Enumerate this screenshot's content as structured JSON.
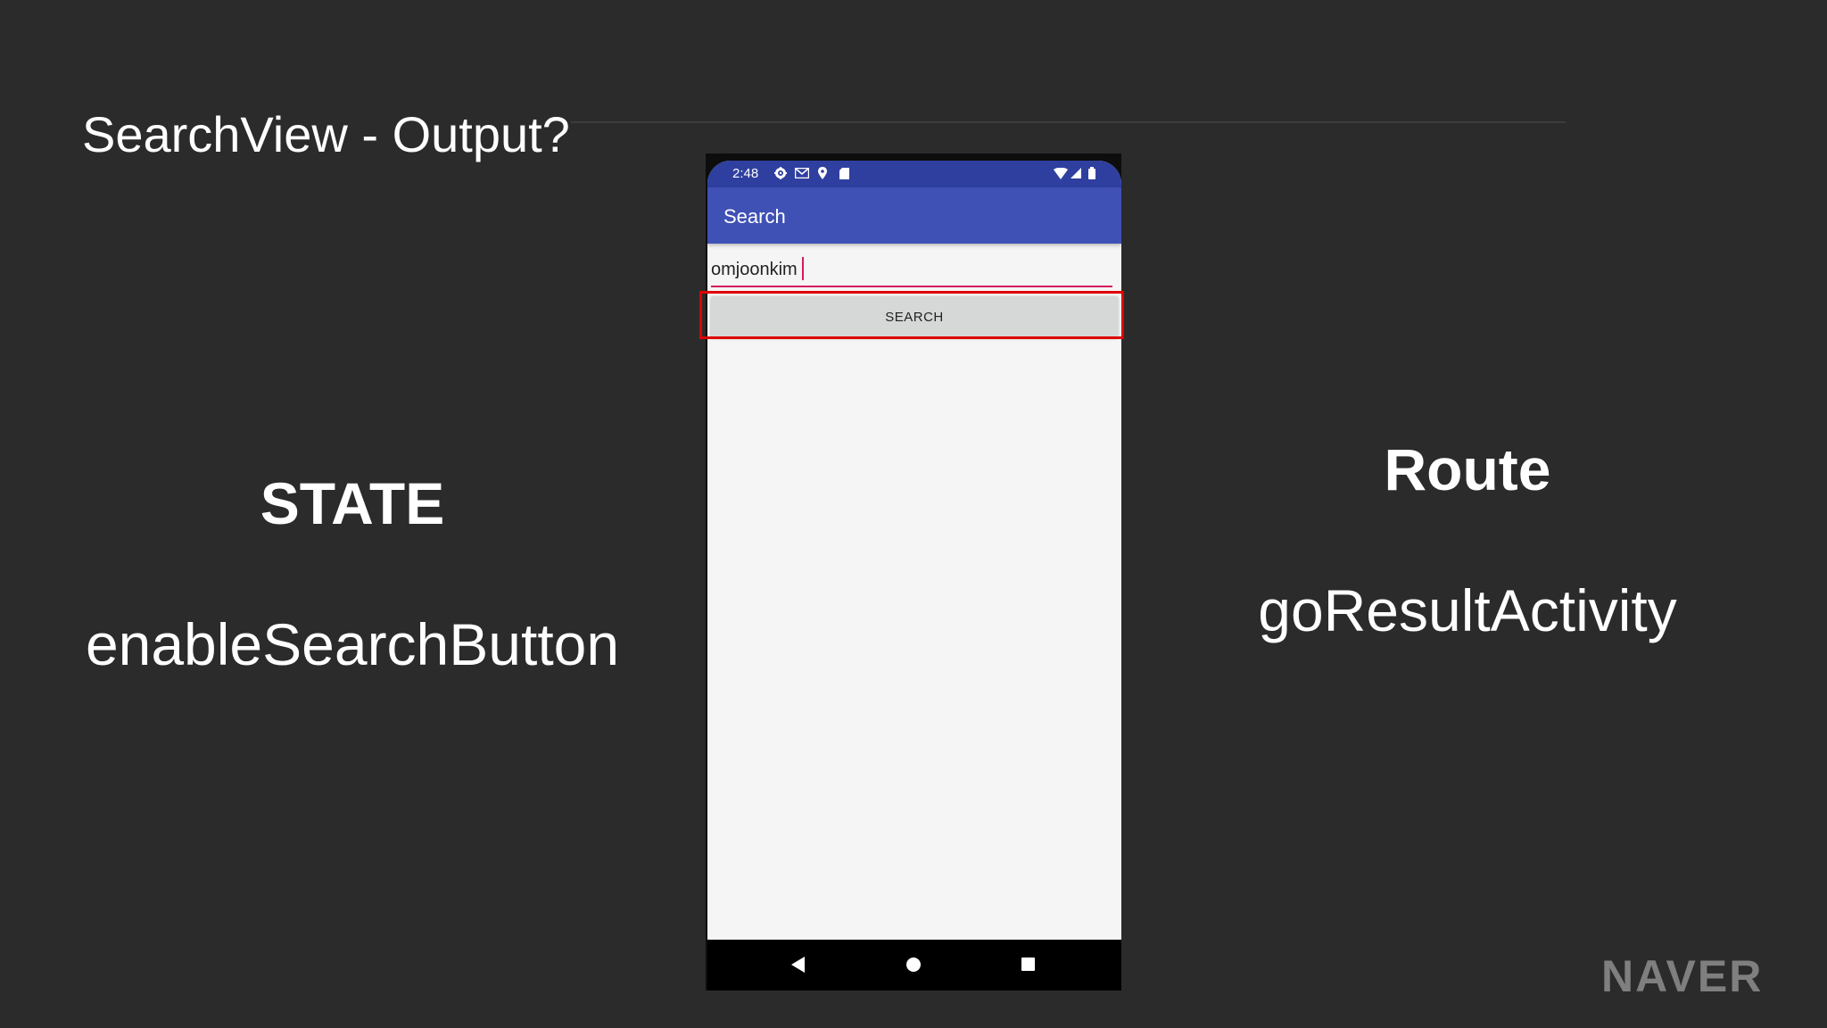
{
  "slide": {
    "title": "SearchView - Output?",
    "state_heading": "STATE",
    "state_value": "enableSearchButton",
    "route_heading": "Route",
    "route_value": "goResultActivity",
    "logo": "NAVER"
  },
  "phone": {
    "status_bar": {
      "time": "2:48",
      "left_icons": [
        "gear-icon",
        "mail-icon",
        "location-icon",
        "sd-card-icon"
      ],
      "right_icons": [
        "wifi-icon",
        "signal-icon",
        "battery-icon"
      ]
    },
    "app_bar": {
      "title": "Search"
    },
    "search": {
      "value": "omjoonkim",
      "button_label": "SEARCH"
    },
    "nav_bar": {
      "buttons": [
        "back-icon",
        "home-icon",
        "recents-icon"
      ]
    }
  },
  "colors": {
    "background": "#2b2b2c",
    "app_bar": "#3f51b5",
    "status_bar": "#2f3fa0",
    "input_underline": "#d81b60",
    "highlight": "#e00000",
    "button": "#d6d7d7"
  }
}
